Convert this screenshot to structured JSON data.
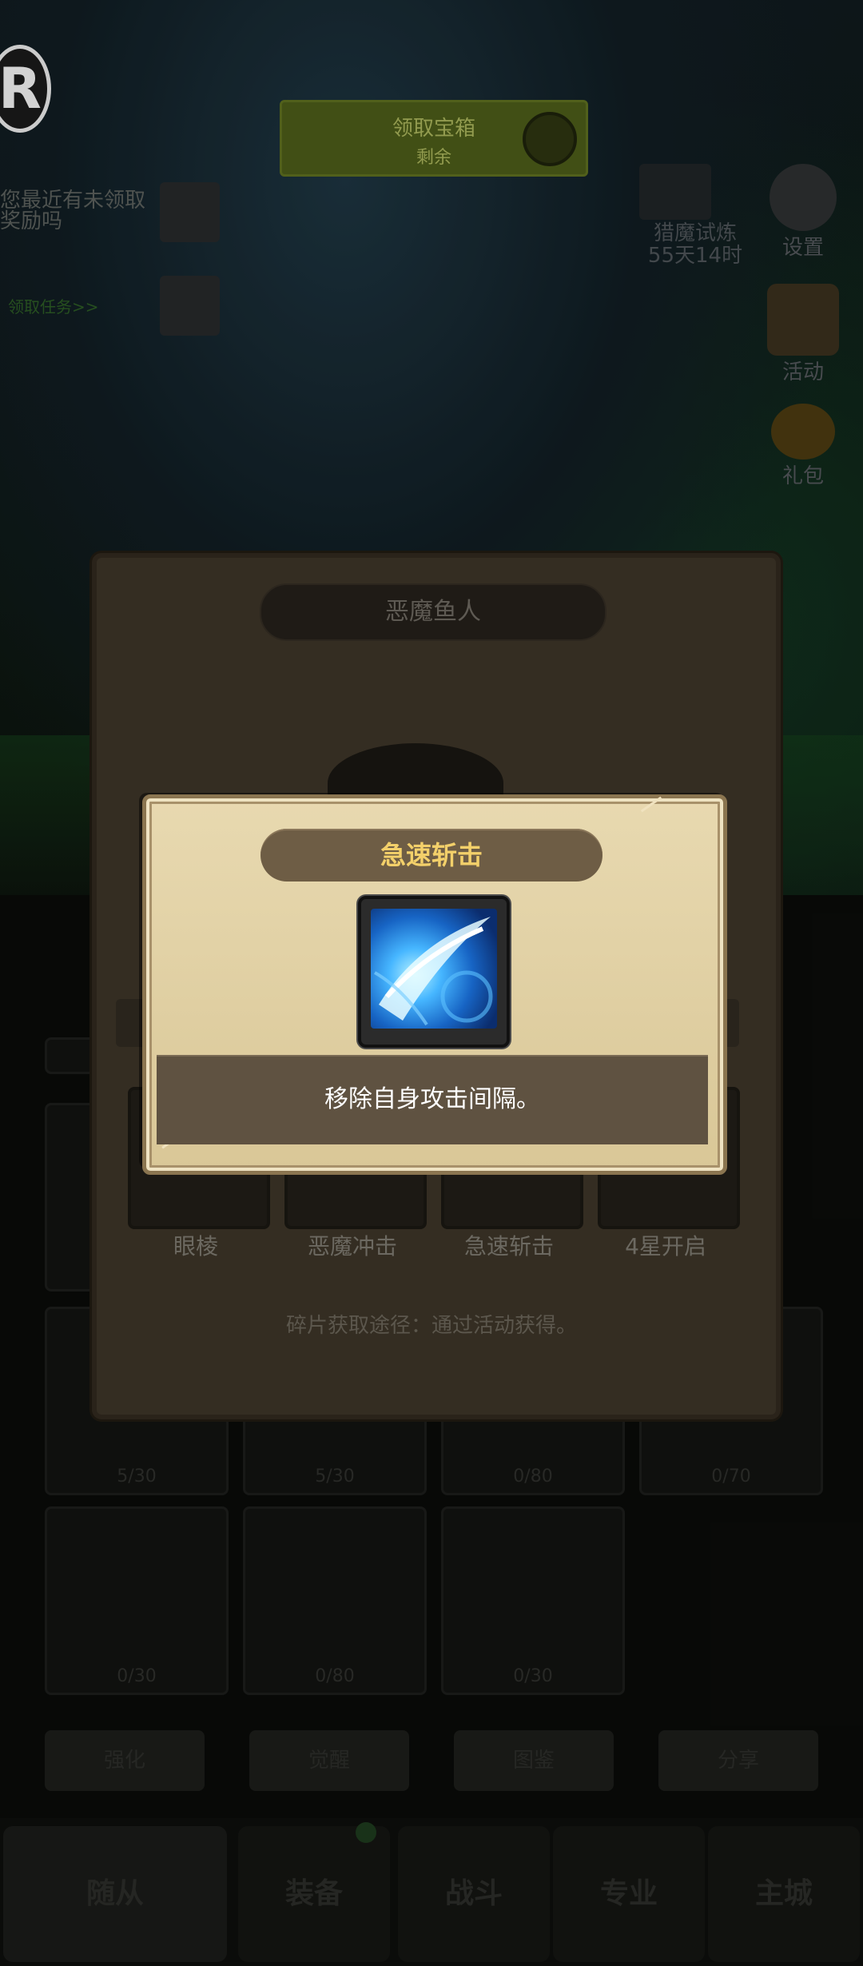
{
  "hud": {
    "logo_letter": "R",
    "banner_line1": "领取宝箱",
    "banner_line2": "剩余",
    "left_text_1": "您最近有未领取奖励吗",
    "left_text_2": "领取任务>>",
    "trial_label": "猎魔试炼",
    "trial_time": "55天14时",
    "settings_label": "设置",
    "events_label": "活动",
    "gift_label": "礼包"
  },
  "hero_dialog": {
    "title": "恶魔鱼人",
    "skills": [
      {
        "name": "眼棱"
      },
      {
        "name": "恶魔冲击"
      },
      {
        "name": "急速斩击"
      },
      {
        "name": "4星开启"
      }
    ],
    "fragment_source": "碎片获取途径：通过活动获得。"
  },
  "skill_popup": {
    "title": "急速斩击",
    "icon": "slash-skill-icon",
    "description": "移除自身攻击间隔。"
  },
  "collection_grid": {
    "counts": [
      "5/30",
      "5/30",
      "0/80",
      "0/70",
      "0/30",
      "0/80",
      "0/30"
    ],
    "buttons": [
      "强化",
      "觉醒",
      "图鉴",
      "分享"
    ]
  },
  "bottom_nav": {
    "tabs": [
      "随从",
      "装备",
      "战斗",
      "专业",
      "主城"
    ]
  },
  "colors": {
    "popup_title_text": "#f3d06a",
    "popup_paper": "#e8d9b0",
    "desc_band": "#5f5241"
  }
}
